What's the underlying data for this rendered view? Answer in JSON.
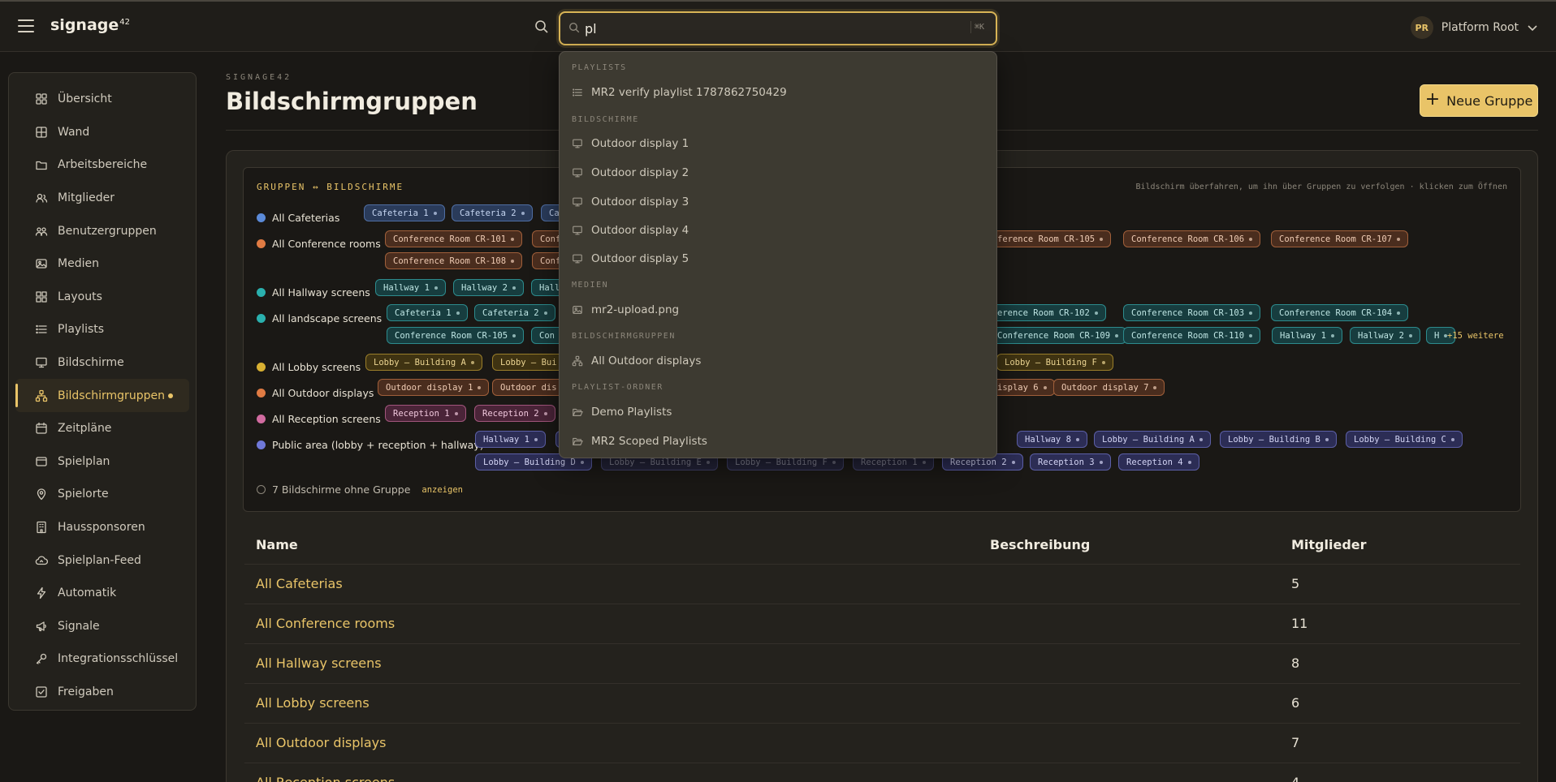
{
  "header": {
    "brand": "signage",
    "brand_sup": "42",
    "search_value": "pl",
    "search_shortcut": "⌘K",
    "user_initials": "PR",
    "user_name": "Platform Root"
  },
  "sidebar": {
    "items": [
      {
        "label": "Übersicht",
        "icon": "grid-icon"
      },
      {
        "label": "Wand",
        "icon": "wall-icon"
      },
      {
        "label": "Arbeitsbereiche",
        "icon": "folder-icon"
      },
      {
        "label": "Mitglieder",
        "icon": "users-icon"
      },
      {
        "label": "Benutzergruppen",
        "icon": "user-groups-icon"
      },
      {
        "label": "Medien",
        "icon": "image-icon"
      },
      {
        "label": "Layouts",
        "icon": "layout-icon"
      },
      {
        "label": "Playlists",
        "icon": "list-icon"
      },
      {
        "label": "Bildschirme",
        "icon": "monitor-icon"
      },
      {
        "label": "Bildschirmgruppen",
        "icon": "network-icon",
        "active": true
      },
      {
        "label": "Zeitpläne",
        "icon": "calendar-icon"
      },
      {
        "label": "Spielplan",
        "icon": "play-icon"
      },
      {
        "label": "Spielorte",
        "icon": "location-icon"
      },
      {
        "label": "Haussponsoren",
        "icon": "building-icon"
      },
      {
        "label": "Spielplan-Feed",
        "icon": "cloud-icon"
      },
      {
        "label": "Automatik",
        "icon": "bolt-icon"
      },
      {
        "label": "Signale",
        "icon": "megaphone-icon"
      },
      {
        "label": "Integrationsschlüssel",
        "icon": "key-icon"
      },
      {
        "label": "Freigaben",
        "icon": "checkbox-icon"
      }
    ]
  },
  "main": {
    "eyebrow": "SIGNAGE42",
    "title": "Bildschirmgruppen",
    "new_group_label": "Neue Gruppe"
  },
  "panel": {
    "title": "GRUPPEN ↔ BILDSCHIRME",
    "hint": "Bildschirm überfahren, um ihn über Gruppen zu verfolgen · klicken zum Öffnen",
    "groups": [
      {
        "label": "All Cafeterias",
        "color": "#5b8ad8"
      },
      {
        "label": "All Conference rooms",
        "color": "#e07b43"
      },
      {
        "label": "All Hallway screens",
        "color": "#2ab0ae"
      },
      {
        "label": "All landscape screens",
        "color": "#2ab0ae"
      },
      {
        "label": "All Lobby screens",
        "color": "#d8b032"
      },
      {
        "label": "All Outdoor displays",
        "color": "#e07b43"
      },
      {
        "label": "All Reception screens",
        "color": "#d16ba0"
      },
      {
        "label": "Public area (lobby + reception + hallway)",
        "color": "#6f78d8"
      }
    ],
    "chips": {
      "cafeterias": [
        "Cafeteria 1",
        "Cafeteria 2",
        "Ca"
      ],
      "conference_row1": [
        "Conference Room CR-101",
        "Conf",
        "ference Room CR-105",
        "Conference Room CR-106",
        "Conference Room CR-107"
      ],
      "conference_row2": [
        "Conference Room CR-108",
        "Conf"
      ],
      "hallway": [
        "Hallway 1",
        "Hallway 2",
        "Hall"
      ],
      "landscape_row1": [
        "Cafeteria 1",
        "Cafeteria 2",
        "Ca",
        "erence Room CR-102",
        "Conference Room CR-103",
        "Conference Room CR-104"
      ],
      "landscape_row2": [
        "Conference Room CR-105",
        "Con",
        "Conference Room CR-109",
        "Conference Room CR-110",
        "Hallway 1",
        "Hallway 2",
        "H"
      ],
      "landscape_more": "+15 weitere",
      "lobby": [
        "Lobby — Building A",
        "Lobby — Bui",
        "Lobby — Building F"
      ],
      "outdoor": [
        "Outdoor display 1",
        "Outdoor dis",
        "isplay 6",
        "Outdoor display 7"
      ],
      "reception": [
        "Reception 1",
        "Reception 2"
      ],
      "public_row1": [
        "Hallway 1",
        "H",
        "Hallway 8",
        "Lobby — Building A",
        "Lobby — Building B",
        "Lobby — Building C"
      ],
      "public_row2": [
        "Lobby — Building D",
        "Lobby — Building E",
        "Lobby — Building F",
        "Reception 1",
        "Reception 2",
        "Reception 3",
        "Reception 4"
      ]
    },
    "ungrouped_text": "7 Bildschirme ohne Gruppe",
    "ungrouped_link": "anzeigen"
  },
  "table": {
    "columns": [
      "Name",
      "Beschreibung",
      "Mitglieder"
    ],
    "rows": [
      {
        "name": "All Cafeterias",
        "description": "",
        "members": "5"
      },
      {
        "name": "All Conference rooms",
        "description": "",
        "members": "11"
      },
      {
        "name": "All Hallway screens",
        "description": "",
        "members": "8"
      },
      {
        "name": "All Lobby screens",
        "description": "",
        "members": "6"
      },
      {
        "name": "All Outdoor displays",
        "description": "",
        "members": "7"
      },
      {
        "name": "All Reception screens",
        "description": "",
        "members": "4"
      }
    ]
  },
  "search_results": {
    "sections": [
      {
        "title": "PLAYLISTS",
        "icon": "list-icon",
        "items": [
          "MR2 verify playlist 1787862750429"
        ]
      },
      {
        "title": "BILDSCHIRME",
        "icon": "monitor-icon",
        "items": [
          "Outdoor display 1",
          "Outdoor display 2",
          "Outdoor display 3",
          "Outdoor display 4",
          "Outdoor display 5"
        ]
      },
      {
        "title": "MEDIEN",
        "icon": "image-icon",
        "items": [
          "mr2-upload.png"
        ]
      },
      {
        "title": "BILDSCHIRMGRUPPEN",
        "icon": "network-icon",
        "items": [
          "All Outdoor displays"
        ]
      },
      {
        "title": "PLAYLIST-ORDNER",
        "icon": "folder-open-icon",
        "items": [
          "Demo Playlists",
          "MR2 Scoped Playlists"
        ]
      }
    ]
  }
}
